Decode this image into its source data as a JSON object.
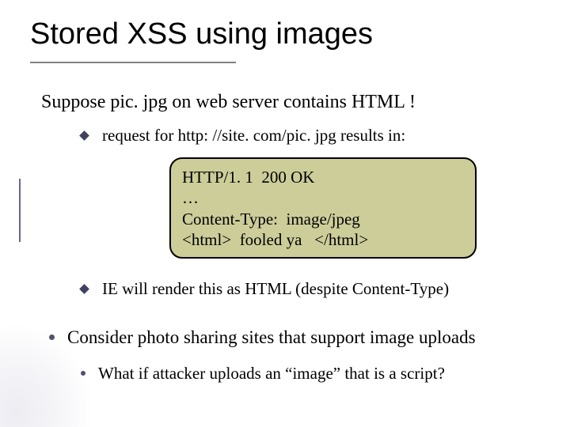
{
  "title": "Stored XSS using images",
  "suppose": {
    "pre": "Suppose   ",
    "file": "pic. jpg",
    "post": "   on web server contains HTML !"
  },
  "request": {
    "pre": "request for    ",
    "url": "http: //site. com/pic. jpg",
    "post": "    results in:"
  },
  "codebox": {
    "l1": "HTTP/1. 1  200 OK",
    "l2": "…",
    "l3": "Content-Type:  image/jpeg",
    "l4": "",
    "l5": "<html>  fooled ya   </html>"
  },
  "ie": {
    "pre": "IE will render this as HTML    ",
    "post": "(despite Content-Type)"
  },
  "consider": "Consider photo sharing sites that support image uploads",
  "whatif": "What if attacker uploads an “image” that is a script?"
}
